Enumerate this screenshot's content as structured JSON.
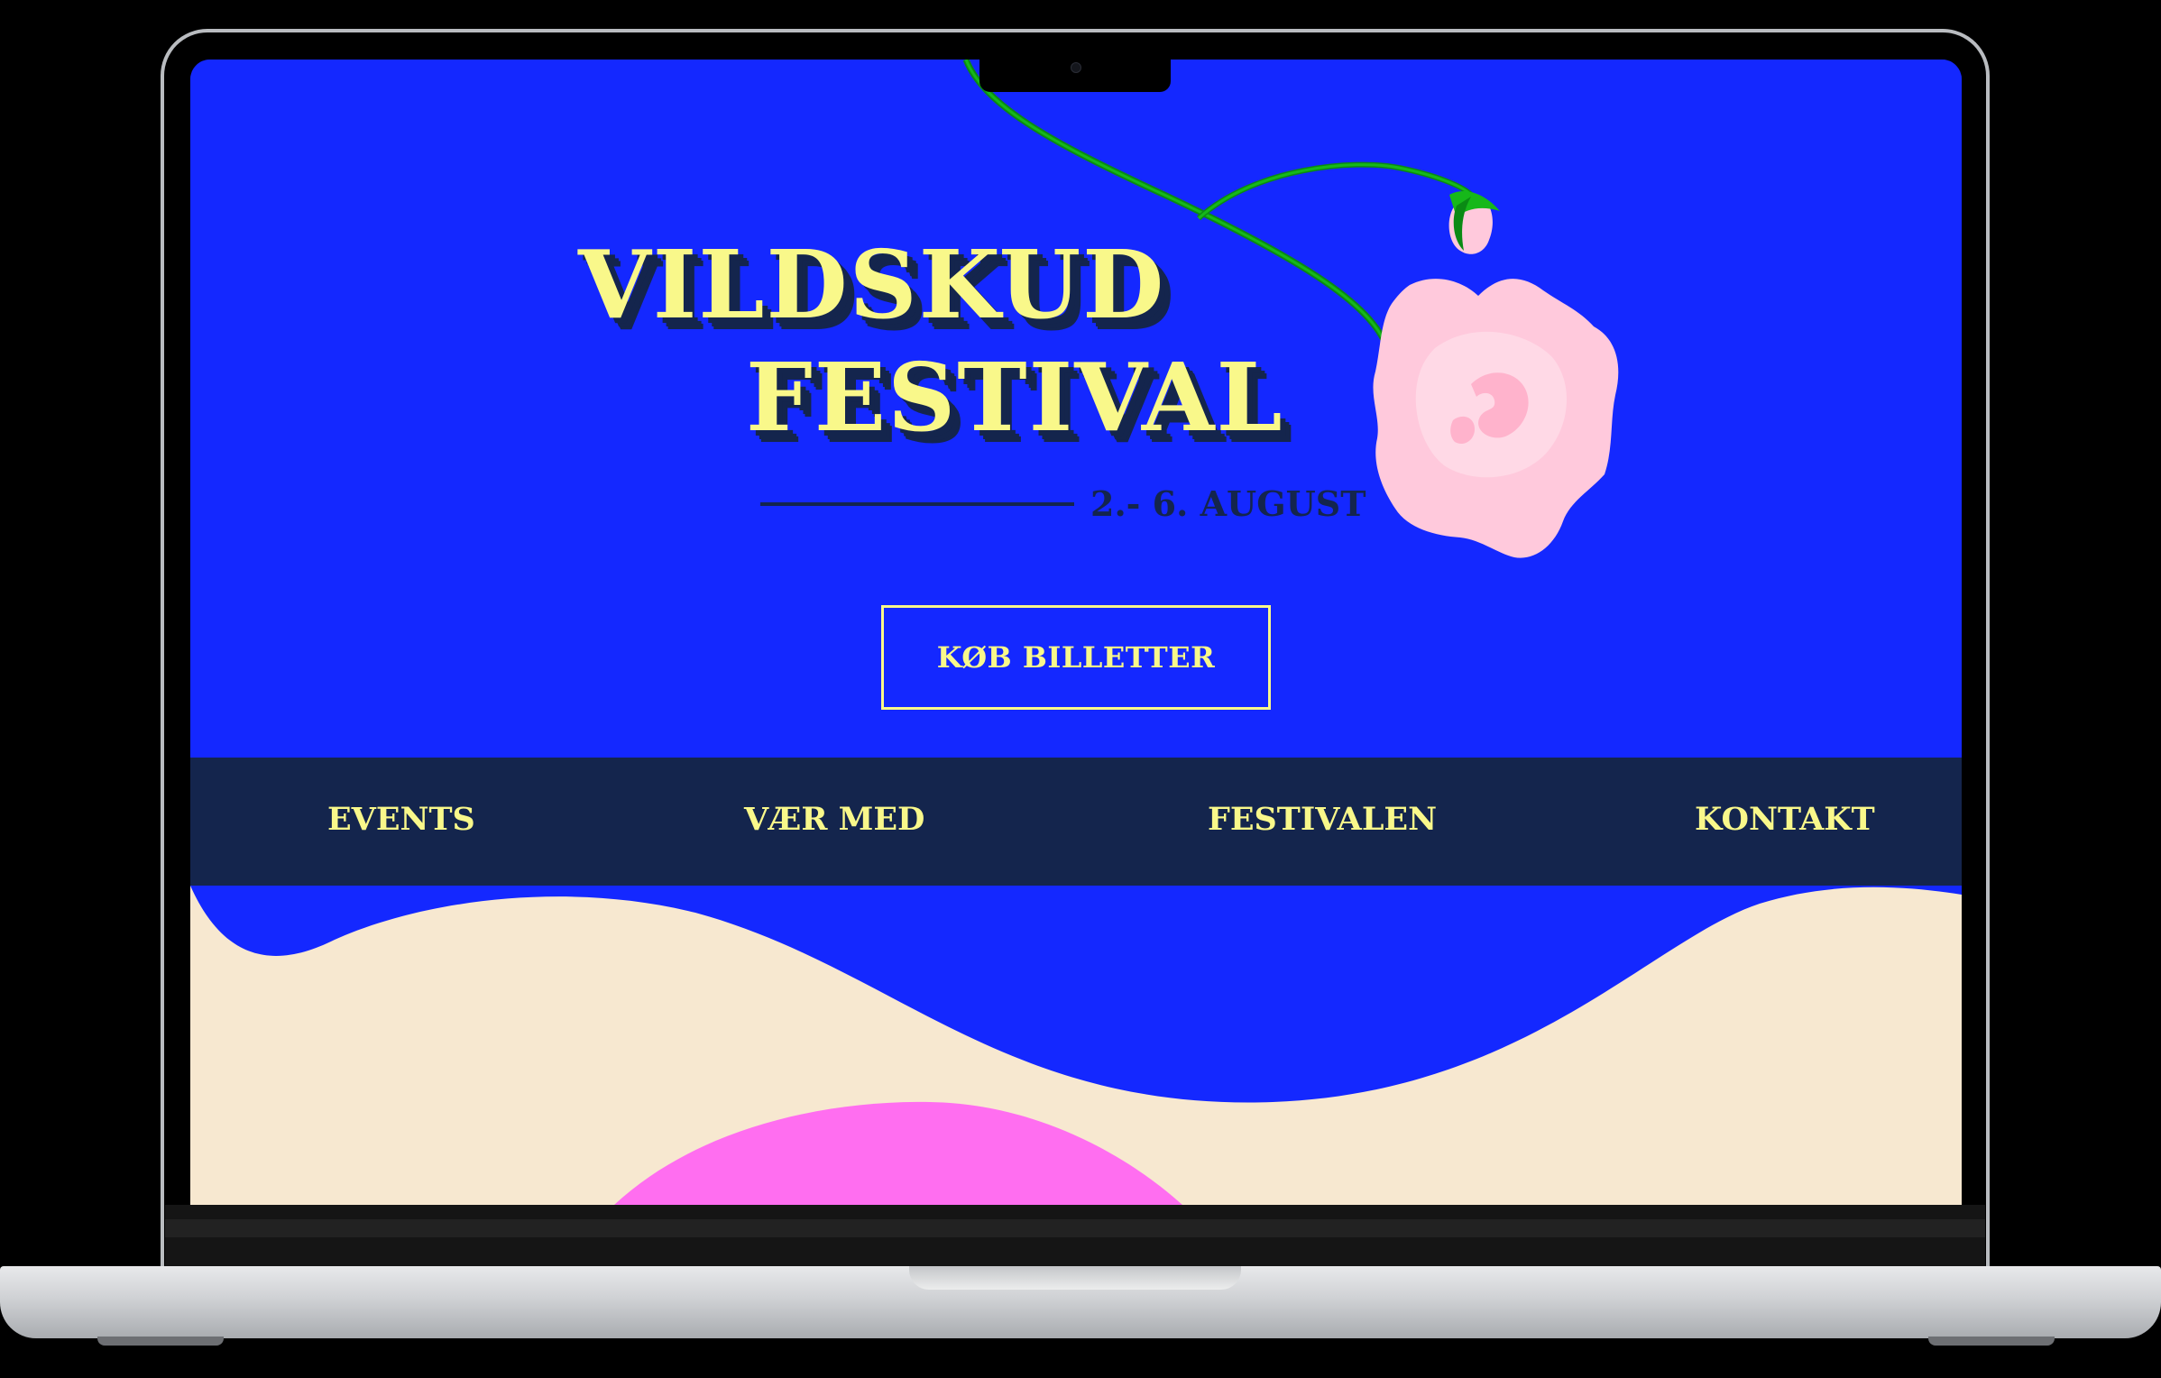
{
  "hero": {
    "title_line_1": "VILDSKUD",
    "title_line_2": "FESTIVAL",
    "dates": "2.- 6. AUGUST",
    "cta_label": "KØB BILLETTER"
  },
  "nav": {
    "items": [
      {
        "label": "EVENTS"
      },
      {
        "label": "VÆR MED"
      },
      {
        "label": "FESTIVALEN"
      },
      {
        "label": "KONTAKT"
      }
    ]
  },
  "colors": {
    "background_blue": "#1428ff",
    "navy": "#14254d",
    "yellow": "#f9f88a",
    "pink_flower": "#ffc9dc",
    "cream": "#f7e8d0",
    "magenta": "#ff6ef0",
    "stem_green": "#16b81a"
  },
  "icons": {
    "decoration": "rose-flower-illustration"
  }
}
